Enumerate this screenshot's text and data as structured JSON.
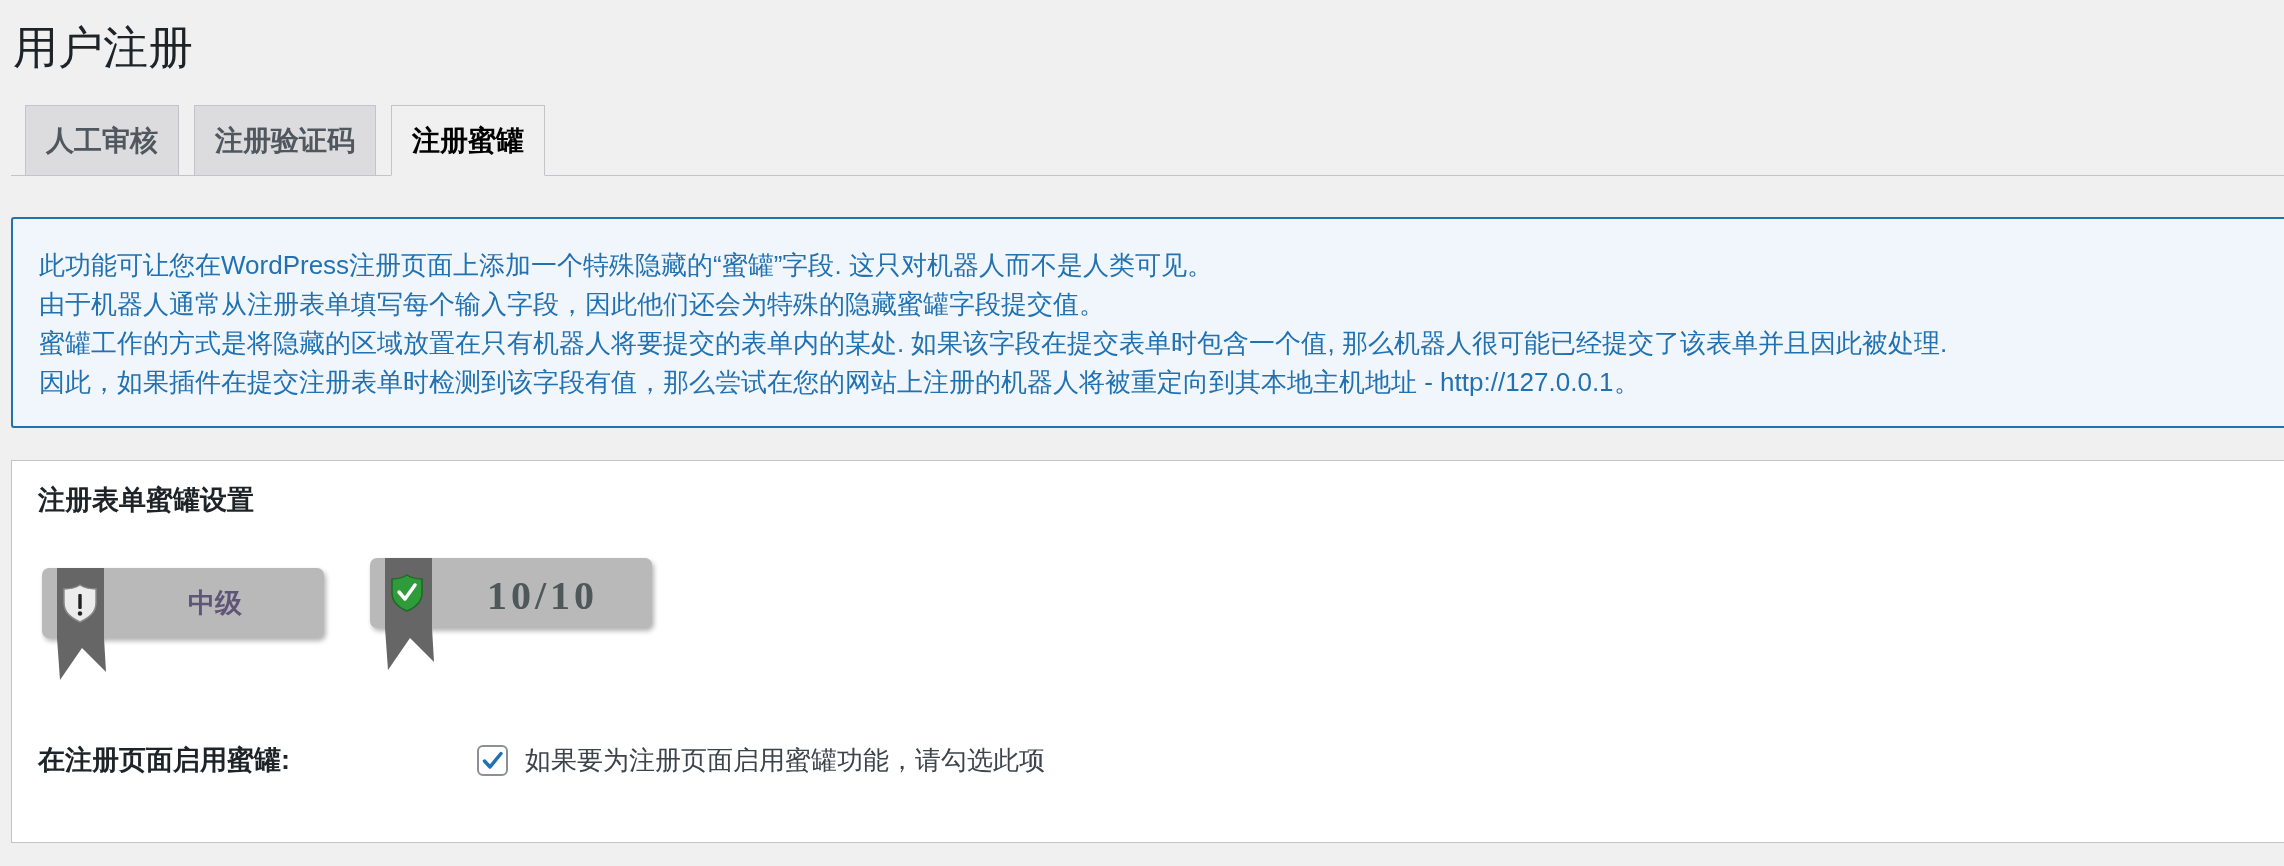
{
  "page": {
    "title": "用户注册"
  },
  "tabs": [
    {
      "label": "人工审核",
      "selected": false
    },
    {
      "label": "注册验证码",
      "selected": false
    },
    {
      "label": "注册蜜罐",
      "selected": true
    }
  ],
  "notice": {
    "lines": [
      "此功能可让您在WordPress注册页面上添加一个特殊隐藏的“蜜罐”字段. 这只对机器人而不是人类可见。",
      "由于机器人通常从注册表单填写每个输入字段，因此他们还会为特殊的隐藏蜜罐字段提交值。",
      "蜜罐工作的方式是将隐藏的区域放置在只有机器人将要提交的表单内的某处. 如果该字段在提交表单时包含一个值, 那么机器人很可能已经提交了该表单并且因此被处理.",
      "因此，如果插件在提交注册表单时检测到该字段有值，那么尝试在您的网站上注册的机器人将被重定向到其本地主机地址 - http://127.0.0.1。"
    ]
  },
  "settings": {
    "heading": "注册表单蜜罐设置",
    "badges": [
      {
        "kind": "level",
        "text": "中级"
      },
      {
        "kind": "score",
        "text": "10/10"
      }
    ],
    "option": {
      "label": "在注册页面启用蜜罐:",
      "checked": true,
      "description": "如果要为注册页面启用蜜罐功能，请勾选此项"
    }
  }
}
